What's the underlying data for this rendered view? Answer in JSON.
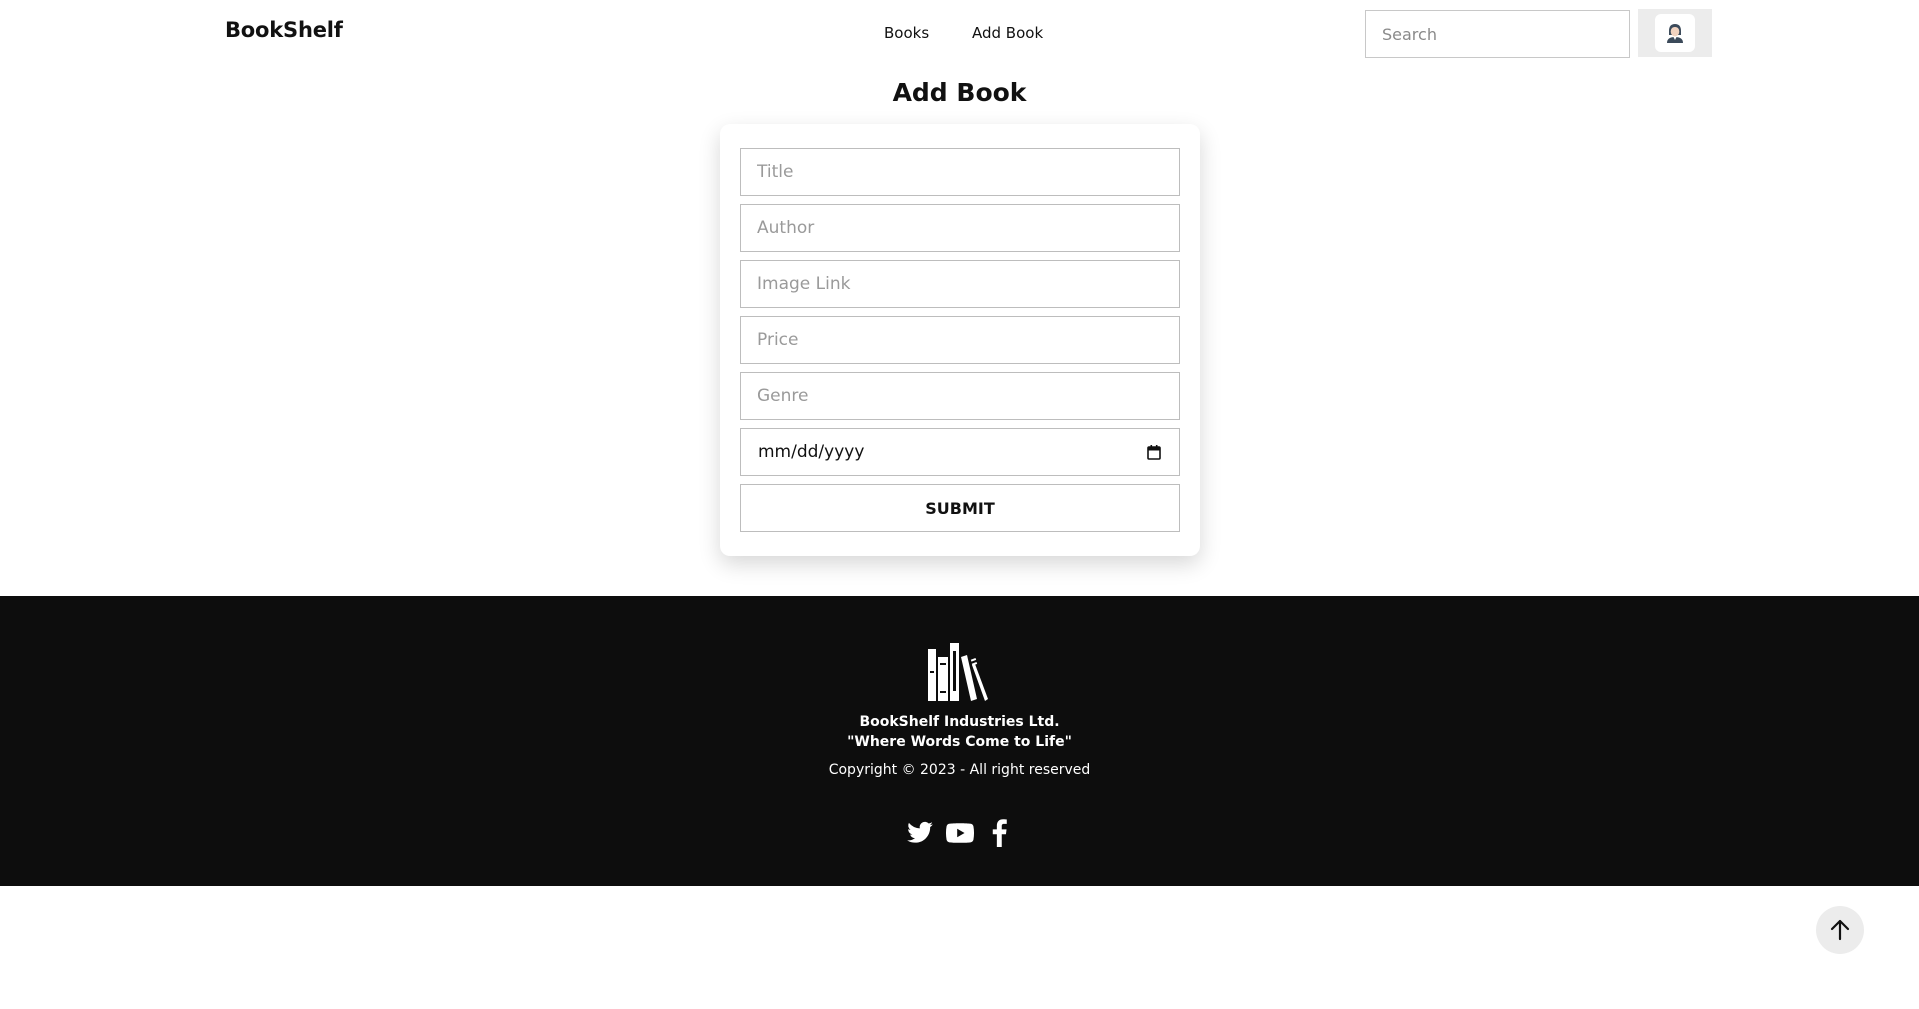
{
  "header": {
    "brand": "BookShelf",
    "nav": [
      {
        "label": "Books"
      },
      {
        "label": "Add Book"
      }
    ],
    "search": {
      "placeholder": "Search",
      "value": ""
    },
    "avatar_icon": "user-avatar-icon"
  },
  "form": {
    "title": "Add Book",
    "fields": {
      "title": {
        "placeholder": "Title",
        "value": ""
      },
      "author": {
        "placeholder": "Author",
        "value": ""
      },
      "image_link": {
        "placeholder": "Image Link",
        "value": ""
      },
      "price": {
        "placeholder": "Price",
        "value": ""
      },
      "genre": {
        "placeholder": "Genre",
        "value": ""
      },
      "date": {
        "placeholder": "mm/dd/yyyy"
      }
    },
    "submit_label": "SUBMIT"
  },
  "footer": {
    "logo_icon": "bookshelf-logo-icon",
    "company": "BookShelf Industries Ltd.",
    "tagline": "\"Where Words Come to Life\"",
    "copyright": "Copyright © 2023 - All right reserved",
    "social_icons": [
      "twitter-icon",
      "youtube-icon",
      "facebook-icon"
    ]
  },
  "back_to_top_icon": "arrow-up-icon",
  "colors": {
    "footer_bg": "#0d0d0d",
    "text": "#111111",
    "avatar_bg": "#ececec"
  }
}
